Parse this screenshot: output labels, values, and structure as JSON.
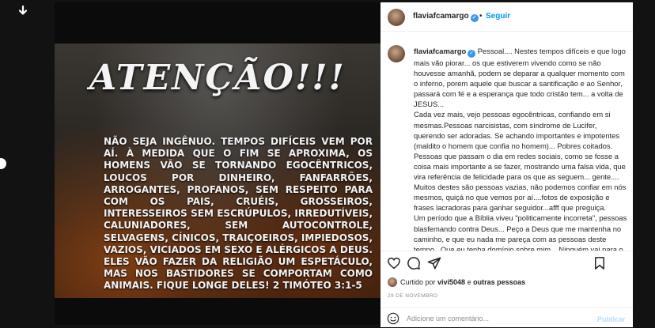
{
  "post": {
    "headline": "ATENÇÃO!!!",
    "text": "Não seja ingênuo. Tempos difíceis vem por aí. À medida que o fim se aproxima, os homens vão se tornando egocêntricos, loucos por dinheiro, fanfarrões, arrogantes, profanos, sem respeito para com os pais, cruéis, grosseiros, interesseiros sem escrúpulos, irredutíveis, caluniadores, sem autocontrole, selvagens, cínicos, traiçoeiros, impiedosos, vazios, viciados em sexo e alérgicos a Deus. Eles vão fazer da religião um espetáculo, mas nos bastidores se comportam como animais. Fique longe deles!    2 Timóteo 3:1-5"
  },
  "header": {
    "username": "flaviafcamargo",
    "verified_mark": "✓",
    "separator": "•",
    "follow_label": "Seguir"
  },
  "caption": {
    "username": "flaviafcamargo",
    "text": "Pessoal.... Nestes tempos difíceis e que logo mais vão piorar... os que estiverem vivendo como se não houvesse amanhã, podem se deparar a qualquer momento com o inferno, porem aquele que buscar a santificação e ao Senhor, passará com fé e a esperança que todo cristão tem... a volta de JESUS...\nCada vez mais, vejo pessoas egocêntricas, confiando em si mesmas.Pessoas narcisistas, com síndrome de Lucifer, querendo ser adoradas. Se achando importantes e impotentes (maldito o homem que confia no homem)... Pobres coitados. Pessoas que passam o dia em redes sociais, como se fosse a coisa mais importante a se fazer, mostrando uma falsa vida, que vira referência de felicidade para os que as seguem... gente.... Muitos destes são pessoas vazias, não podemos confiar em nós mesmos, quiçá no que vemos por aí....fotos de exposição e frases lacradoras para ganhar seguidor...afff que preguiça.\nUm período que a Bíblia viveu \"politicamente incorreta\", pessoas blasfemando contra Deus... Peço a Deus que me mantenha no caminho, e que eu nada me pareça com as pessoas deste tempo...Que eu tenha domínio sobre mim... Ninguém vai para o céu por obras, ou por \"ser bonzinho\"... nenhum de nós é digno do céu, aaaa se não fosse por Jesus... pela graça de Deus... não"
  },
  "likes": {
    "prefix": "Curtido por ",
    "user": "vivi5048",
    "middle": " e ",
    "others": "outras pessoas"
  },
  "date": "29 DE NOVEMBRO",
  "comment": {
    "placeholder": "Adicione um comentário...",
    "publish_label": "Publicar"
  },
  "icons": {
    "download": "download-arrow-icon",
    "like": "heart-icon",
    "comment": "comment-bubble-icon",
    "share": "paper-plane-icon",
    "save": "bookmark-icon",
    "emoji": "emoji-icon"
  },
  "colors": {
    "link_blue": "#0095f6",
    "verified_blue": "#3897f0",
    "publish_disabled": "#b2dffc"
  }
}
